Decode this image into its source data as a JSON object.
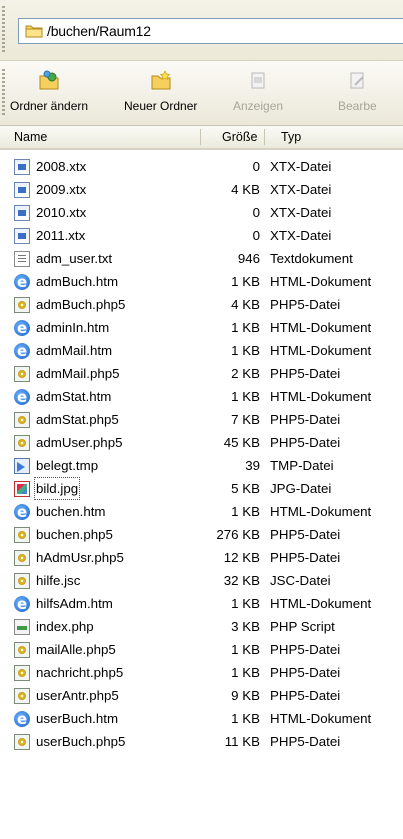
{
  "address": {
    "path": "/buchen/Raum12"
  },
  "toolbar": {
    "buttons": [
      {
        "label": "Ordner ändern",
        "icon": "folder-change-icon",
        "enabled": true
      },
      {
        "label": "Neuer Ordner",
        "icon": "new-folder-icon",
        "enabled": true
      },
      {
        "label": "Anzeigen",
        "icon": "view-icon",
        "enabled": false
      },
      {
        "label": "Bearbe",
        "icon": "edit-icon",
        "enabled": false
      }
    ]
  },
  "columns": {
    "name": "Name",
    "size": "Größe",
    "type": "Typ"
  },
  "files": [
    {
      "name": "2008.xtx",
      "size": "0",
      "type": "XTX-Datei",
      "icon": "xtx-file-icon"
    },
    {
      "name": "2009.xtx",
      "size": "4 KB",
      "type": "XTX-Datei",
      "icon": "xtx-file-icon"
    },
    {
      "name": "2010.xtx",
      "size": "0",
      "type": "XTX-Datei",
      "icon": "xtx-file-icon"
    },
    {
      "name": "2011.xtx",
      "size": "0",
      "type": "XTX-Datei",
      "icon": "xtx-file-icon"
    },
    {
      "name": "adm_user.txt",
      "size": "946",
      "type": "Textdokument",
      "icon": "text-file-icon"
    },
    {
      "name": "admBuch.htm",
      "size": "1 KB",
      "type": "HTML-Dokument",
      "icon": "html-file-icon"
    },
    {
      "name": "admBuch.php5",
      "size": "4 KB",
      "type": "PHP5-Datei",
      "icon": "php5-file-icon"
    },
    {
      "name": "adminIn.htm",
      "size": "1 KB",
      "type": "HTML-Dokument",
      "icon": "html-file-icon"
    },
    {
      "name": "admMail.htm",
      "size": "1 KB",
      "type": "HTML-Dokument",
      "icon": "html-file-icon"
    },
    {
      "name": "admMail.php5",
      "size": "2 KB",
      "type": "PHP5-Datei",
      "icon": "php5-file-icon"
    },
    {
      "name": "admStat.htm",
      "size": "1 KB",
      "type": "HTML-Dokument",
      "icon": "html-file-icon"
    },
    {
      "name": "admStat.php5",
      "size": "7 KB",
      "type": "PHP5-Datei",
      "icon": "php5-file-icon"
    },
    {
      "name": "admUser.php5",
      "size": "45 KB",
      "type": "PHP5-Datei",
      "icon": "php5-file-icon"
    },
    {
      "name": "belegt.tmp",
      "size": "39",
      "type": "TMP-Datei",
      "icon": "tmp-file-icon"
    },
    {
      "name": "bild.jpg",
      "size": "5 KB",
      "type": "JPG-Datei",
      "icon": "jpg-file-icon",
      "focused": true
    },
    {
      "name": "buchen.htm",
      "size": "1 KB",
      "type": "HTML-Dokument",
      "icon": "html-file-icon"
    },
    {
      "name": "buchen.php5",
      "size": "276 KB",
      "type": "PHP5-Datei",
      "icon": "php5-file-icon"
    },
    {
      "name": "hAdmUsr.php5",
      "size": "12 KB",
      "type": "PHP5-Datei",
      "icon": "php5-file-icon"
    },
    {
      "name": "hilfe.jsc",
      "size": "32 KB",
      "type": "JSC-Datei",
      "icon": "php5-file-icon"
    },
    {
      "name": "hilfsAdm.htm",
      "size": "1 KB",
      "type": "HTML-Dokument",
      "icon": "html-file-icon"
    },
    {
      "name": "index.php",
      "size": "3 KB",
      "type": "PHP Script",
      "icon": "php-script-icon"
    },
    {
      "name": "mailAlle.php5",
      "size": "1 KB",
      "type": "PHP5-Datei",
      "icon": "php5-file-icon"
    },
    {
      "name": "nachricht.php5",
      "size": "1 KB",
      "type": "PHP5-Datei",
      "icon": "php5-file-icon"
    },
    {
      "name": "userAntr.php5",
      "size": "9 KB",
      "type": "PHP5-Datei",
      "icon": "php5-file-icon"
    },
    {
      "name": "userBuch.htm",
      "size": "1 KB",
      "type": "HTML-Dokument",
      "icon": "html-file-icon"
    },
    {
      "name": "userBuch.php5",
      "size": "11 KB",
      "type": "PHP5-Datei",
      "icon": "php5-file-icon"
    }
  ]
}
